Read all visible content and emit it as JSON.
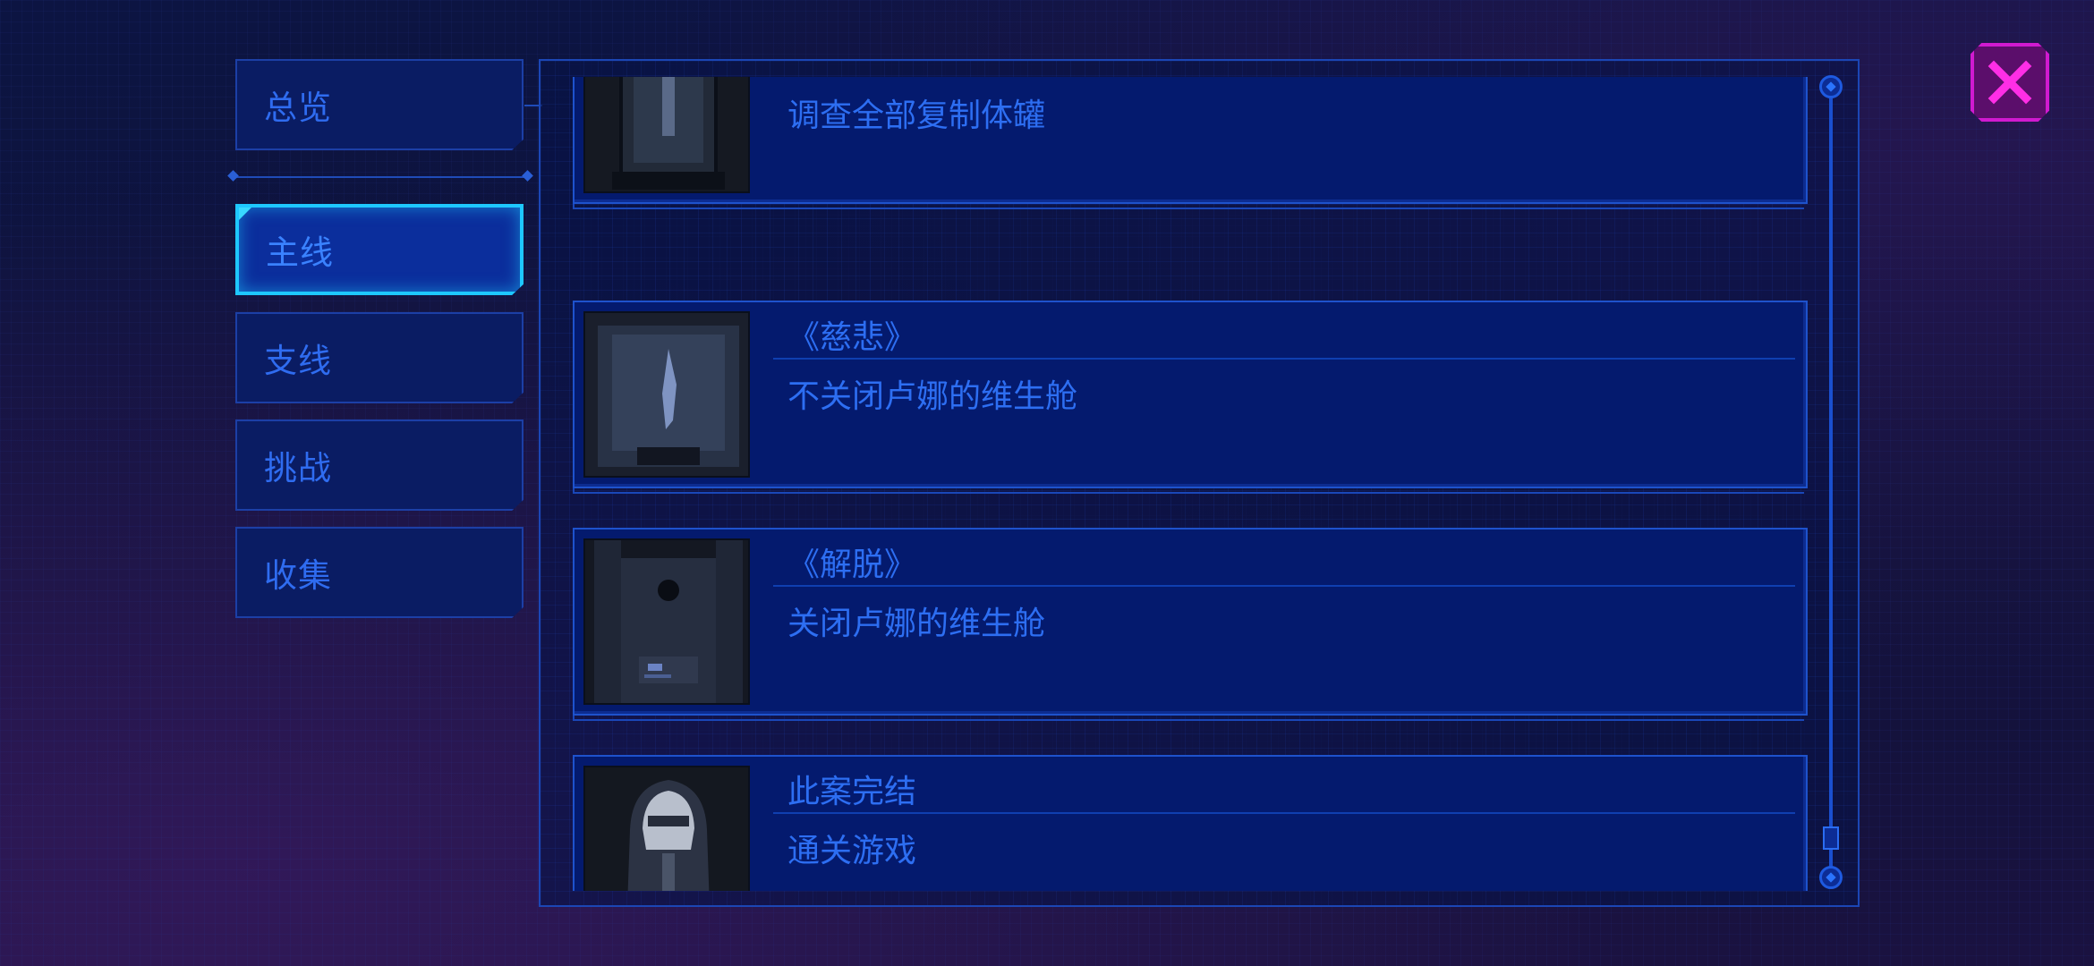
{
  "sidebar": {
    "items": [
      {
        "label": "总览"
      },
      {
        "label": "主线"
      },
      {
        "label": "支线"
      },
      {
        "label": "挑战"
      },
      {
        "label": "收集"
      }
    ],
    "active": "主线"
  },
  "achievements": [
    {
      "title": "",
      "desc": "调查全部复制体罐",
      "thumb": "replica-tank-thumb"
    },
    {
      "title": "《慈悲》",
      "desc": "不关闭卢娜的维生舱",
      "thumb": "life-support-pod-thumb"
    },
    {
      "title": "《解脱》",
      "desc": "关闭卢娜的维生舱",
      "thumb": "machine-room-thumb"
    },
    {
      "title": "此案完结",
      "desc": "通关游戏",
      "thumb": "hooded-figure-thumb"
    }
  ],
  "icons": {
    "close": "close-icon"
  },
  "colors": {
    "accent": "#2d6ef2",
    "active_border": "#1ec7ff",
    "close": "#d01ad0"
  }
}
